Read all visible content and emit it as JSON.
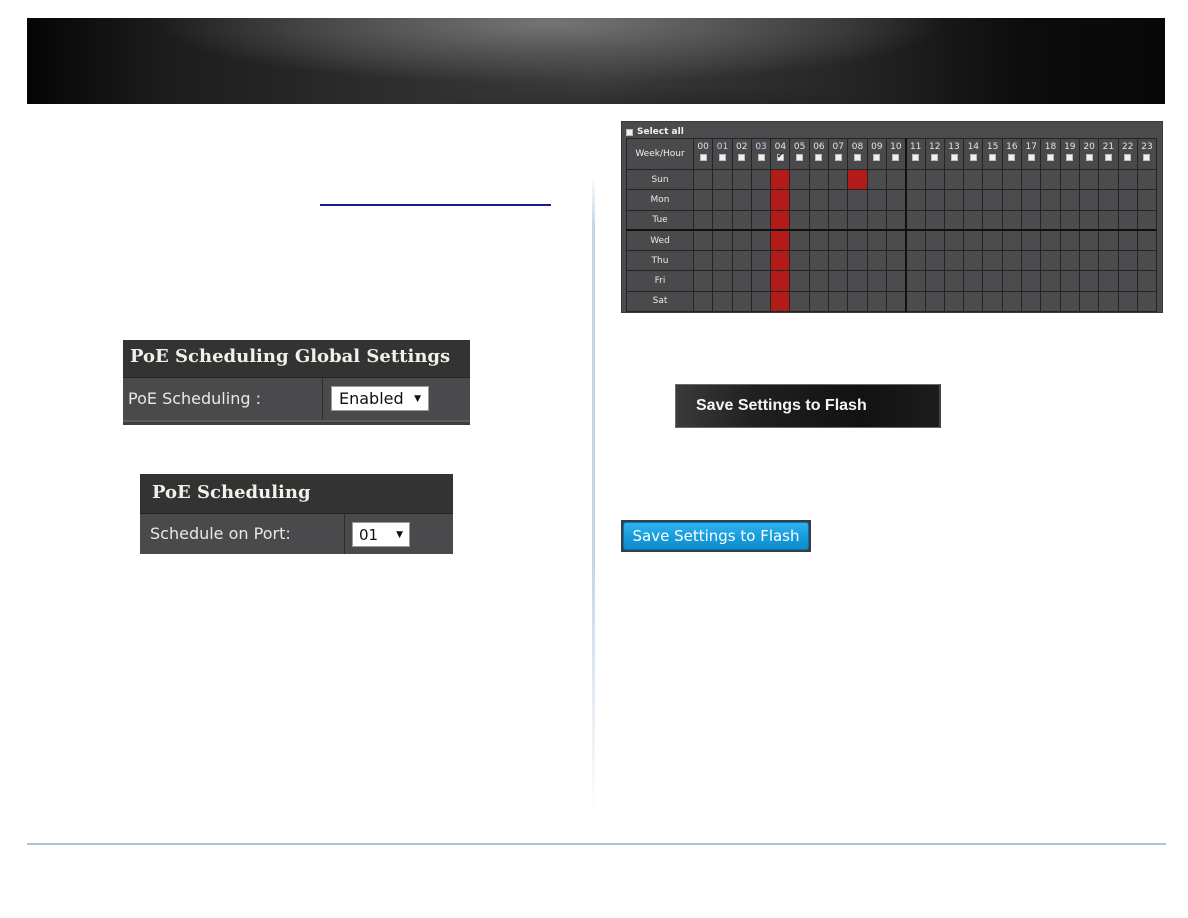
{
  "header": {
    "banner": "dark-gradient-banner"
  },
  "global_settings": {
    "title": "PoE Scheduling Global Settings",
    "label": "PoE Scheduling :",
    "selected": "Enabled",
    "arrow": "▼"
  },
  "port_settings": {
    "title": "PoE Scheduling",
    "label": "Schedule on Port:",
    "selected": "01",
    "arrow": "▼"
  },
  "schedule": {
    "select_all_label": "Select all",
    "corner_label": "Week/Hour",
    "hours": [
      "00",
      "01",
      "02",
      "03",
      "04",
      "05",
      "06",
      "07",
      "08",
      "09",
      "10",
      "11",
      "12",
      "13",
      "14",
      "15",
      "16",
      "17",
      "18",
      "19",
      "20",
      "21",
      "22",
      "23"
    ],
    "checked_hours": [
      "04"
    ],
    "days": [
      "Sun",
      "Mon",
      "Tue",
      "Wed",
      "Thu",
      "Fri",
      "Sat"
    ],
    "active_cells": {
      "Sun": [
        "04",
        "08"
      ],
      "Mon": [
        "04"
      ],
      "Tue": [
        "04"
      ],
      "Wed": [
        "04"
      ],
      "Thu": [
        "04"
      ],
      "Fri": [
        "04"
      ],
      "Sat": [
        "04"
      ]
    },
    "active_color": "#b31b1b"
  },
  "buttons": {
    "save_dark": "Save Settings to Flash",
    "save_blue": "Save Settings to Flash"
  },
  "colors": {
    "panel_bg": "#3e3e3e",
    "accent_blue": "#169bdc",
    "footer_line": "#a8c4de"
  }
}
